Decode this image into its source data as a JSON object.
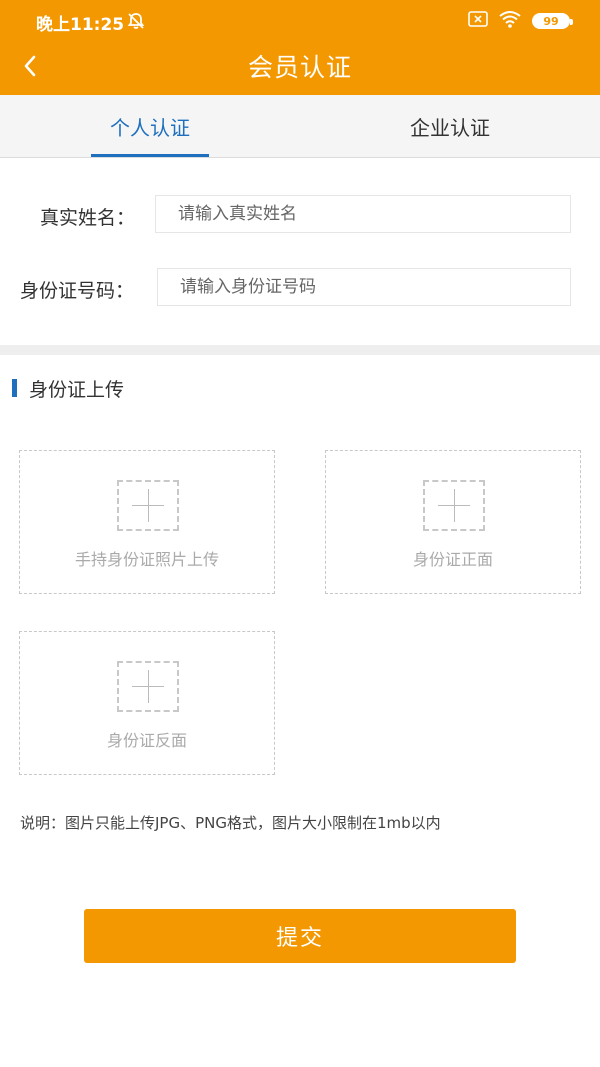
{
  "status_bar": {
    "time": "晚上11:25",
    "battery": "99",
    "icons": [
      "alarm-off-icon",
      "sim-none-icon",
      "wifi-icon",
      "battery-icon"
    ]
  },
  "header": {
    "title": "会员认证",
    "back_icon": "chevron-left-icon"
  },
  "tabs": [
    {
      "label": "个人认证",
      "active": true
    },
    {
      "label": "企业认证",
      "active": false
    }
  ],
  "form": {
    "real_name": {
      "label": "真实姓名：",
      "placeholder": "请输入真实姓名",
      "value": ""
    },
    "id_number": {
      "label": "身份证号码：",
      "placeholder": "请输入身份证号码",
      "value": ""
    }
  },
  "upload": {
    "section_title": "身份证上传",
    "items": [
      {
        "label": "手持身份证照片上传"
      },
      {
        "label": "身份证正面"
      },
      {
        "label": "身份证反面"
      }
    ]
  },
  "note": "说明：图片只能上传JPG、PNG格式，图片大小限制在1mb以内",
  "submit_label": "提交",
  "colors": {
    "brand": "#f39800",
    "accent": "#1e6fbe"
  }
}
